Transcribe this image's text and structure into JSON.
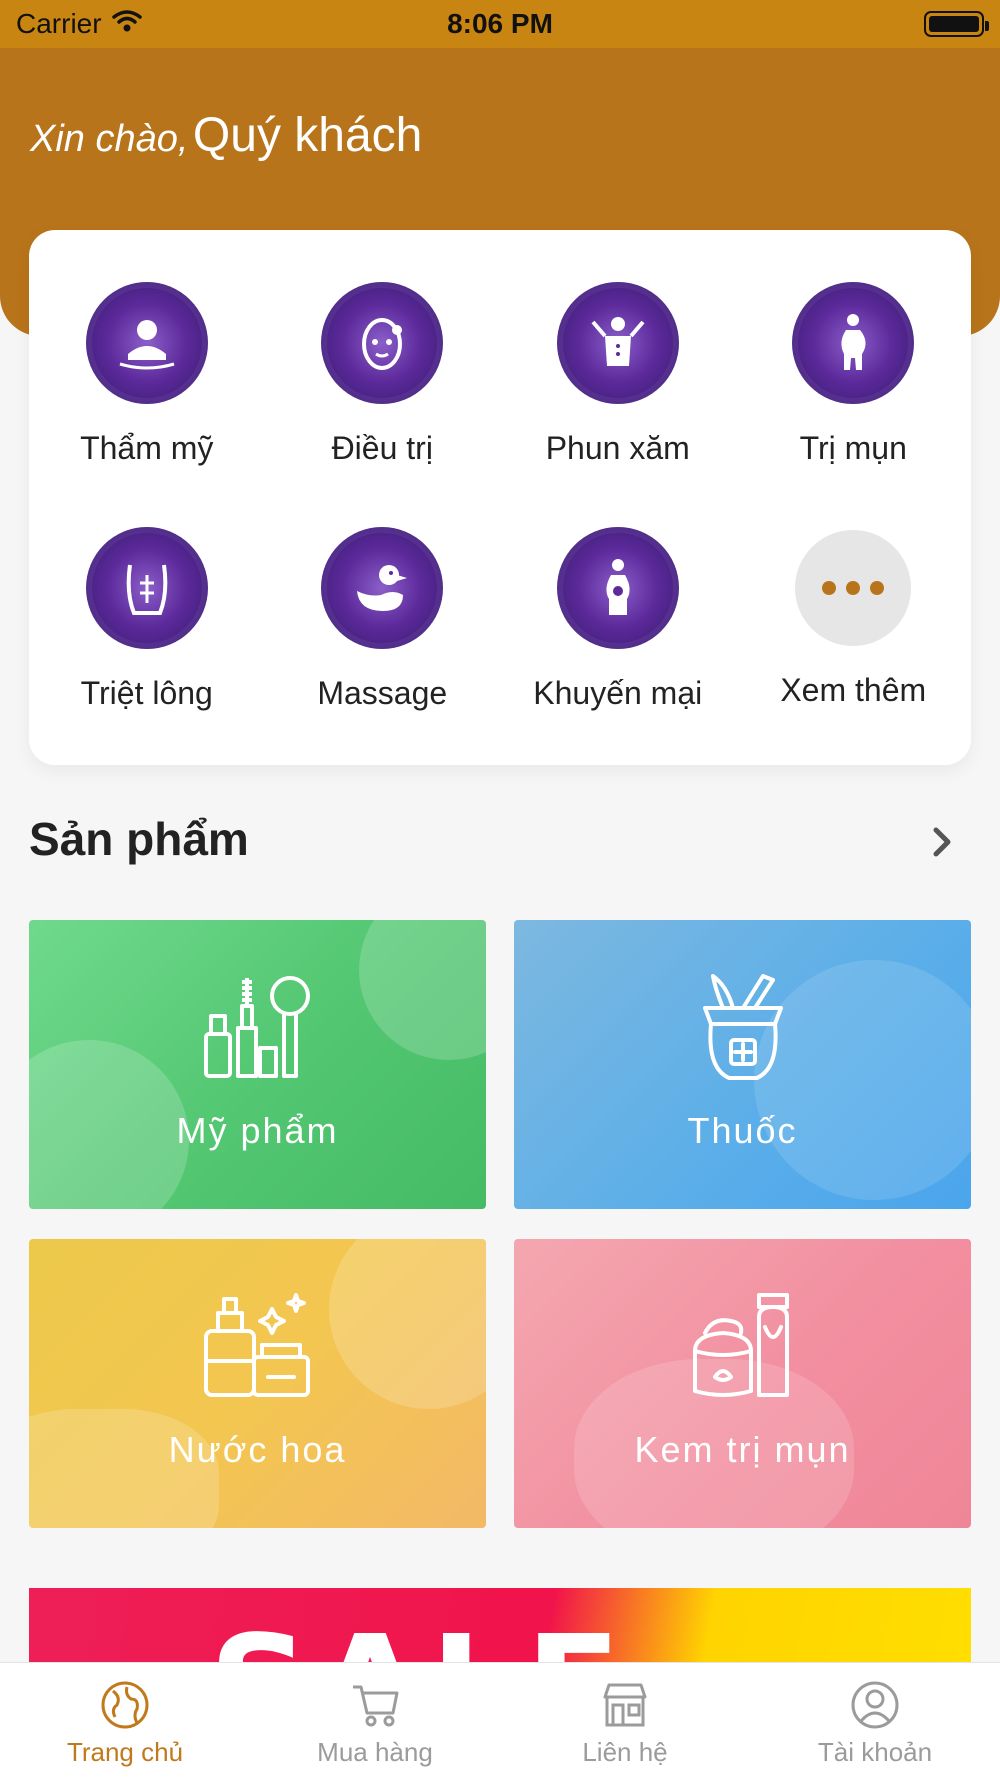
{
  "status_bar": {
    "carrier": "Carrier",
    "time": "8:06 PM"
  },
  "header": {
    "greeting_prefix": "Xin chào,",
    "greeting_name": "Quý khách"
  },
  "categories": [
    {
      "label": "Thẩm mỹ",
      "icon": "spa-face-icon"
    },
    {
      "label": "Điều trị",
      "icon": "face-mask-icon"
    },
    {
      "label": "Phun xăm",
      "icon": "body-tattoo-icon"
    },
    {
      "label": "Trị mụn",
      "icon": "pregnant-woman-icon"
    },
    {
      "label": "Triệt lông",
      "icon": "body-hair-removal-icon"
    },
    {
      "label": "Massage",
      "icon": "duck-icon"
    },
    {
      "label": "Khuyến mại",
      "icon": "woman-promo-icon"
    },
    {
      "label": "Xem thêm",
      "icon": "more-icon"
    }
  ],
  "products": {
    "title": "Sản phẩm",
    "items": [
      {
        "label": "Mỹ phẩm",
        "icon": "cosmetics-icon"
      },
      {
        "label": "Thuốc",
        "icon": "medicine-icon"
      },
      {
        "label": "Nước hoa",
        "icon": "perfume-icon"
      },
      {
        "label": "Kem trị mụn",
        "icon": "cream-icon"
      }
    ]
  },
  "banner": {
    "text": "SALE"
  },
  "tabbar": {
    "items": [
      {
        "label": "Trang chủ",
        "icon": "globe-icon",
        "active": true
      },
      {
        "label": "Mua hàng",
        "icon": "cart-icon",
        "active": false
      },
      {
        "label": "Liên hệ",
        "icon": "store-icon",
        "active": false
      },
      {
        "label": "Tài khoản",
        "icon": "user-icon",
        "active": false
      }
    ]
  },
  "colors": {
    "brand": "#b8741a",
    "status_bar": "#c98512",
    "category_icon": "#5d2a9b",
    "tile_green": "#52c671",
    "tile_blue": "#5aaee9",
    "tile_yellow": "#f3c650",
    "tile_pink": "#f28fa0",
    "tab_active": "#c07a1c",
    "tab_inactive": "#9b9b9b"
  }
}
